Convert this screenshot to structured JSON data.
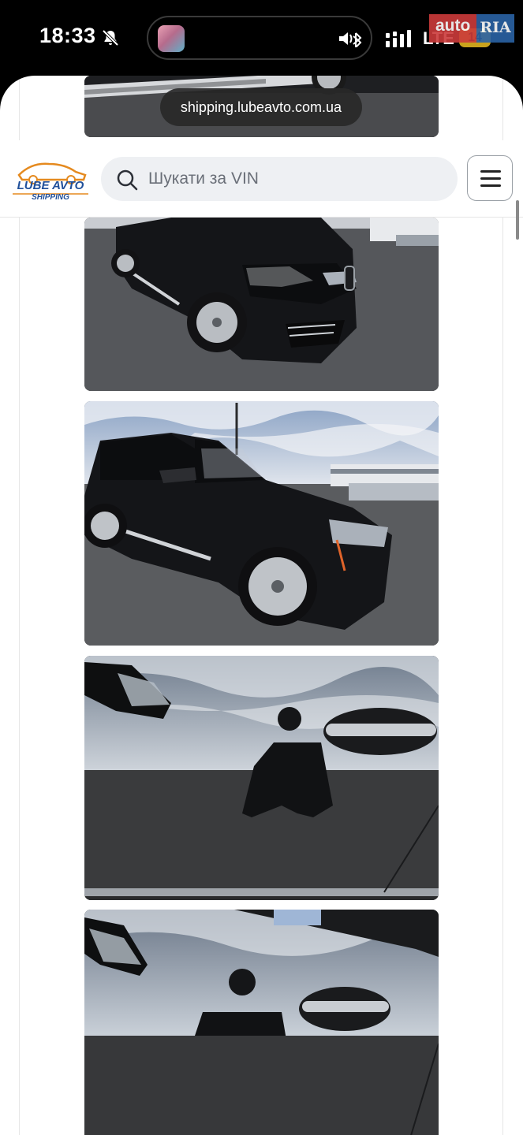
{
  "status_bar": {
    "time": "18:33",
    "network": "LTE",
    "battery": "14"
  },
  "watermark": {
    "part1": "auto",
    "part2": "RIA"
  },
  "browser": {
    "url": "shipping.lubeavto.com.ua"
  },
  "header": {
    "logo_line1": "LUBE AVTO",
    "logo_line2": "SHIPPING",
    "search_placeholder": "Шукати за VIN"
  },
  "icons": [
    "bell-muted-icon",
    "volume-icon",
    "bluetooth-icon",
    "signal-icon",
    "search-icon",
    "menu-icon"
  ],
  "colors": {
    "accent_orange": "#e58a1f",
    "accent_blue": "#1f4f9a",
    "watermark_red": "#cc3b3b",
    "watermark_blue": "#2b63a6"
  }
}
